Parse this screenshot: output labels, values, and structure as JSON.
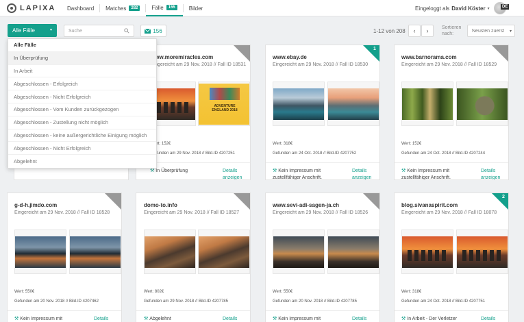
{
  "app": {
    "logo_text": "LAPIXA"
  },
  "nav": {
    "items": [
      {
        "label": "Dashboard"
      },
      {
        "label": "Matches",
        "badge": "282"
      },
      {
        "label": "Fälle",
        "badge": "155"
      },
      {
        "label": "Bilder"
      }
    ],
    "active": "Fälle"
  },
  "user": {
    "prefix": "Eingeloggt als",
    "name": "David Köster",
    "language": "DE"
  },
  "toolbar": {
    "filter_label": "Alle Fälle",
    "search_placeholder": "Suche",
    "mail_count": "156",
    "pager_text": "1-12 von 208",
    "prev_icon": "chevron-left-icon",
    "next_icon": "chevron-right-icon",
    "sort_label_1": "Sortieren",
    "sort_label_2": "nach:",
    "sort_value": "Neusten zuerst"
  },
  "dropdown": {
    "items": [
      "Alle Fälle",
      "In Überprüfung",
      "In Arbeit",
      "Abgeschlossen - Erfolgreich",
      "Abgeschlossen - Nicht Erfolgreich",
      "Abgeschlossen - Vom Kunden zurückgezogen",
      "Abgeschlossen - Zustellung nicht möglich",
      "Abgeschlossen - keine außergerichtliche Einigung möglich",
      "Abgeschlossen - Nicht Erfolgreich",
      "Abgelehnt"
    ],
    "hovered_index": 1
  },
  "cards": [
    {
      "domain": "",
      "meta": "",
      "wert": "",
      "found": "",
      "status": "",
      "details": "",
      "corner": ""
    },
    {
      "domain": "www.moremiracles.com",
      "meta": "Eingereicht am 29 Nov. 2018 // Fall ID 18531",
      "wert": "Wert: 152€",
      "found": "Gefunden am 29 Nov. 2018 // Bild-ID 4207251",
      "status": "In Überprüfung",
      "details": "Details anzeigen",
      "corner": "",
      "book_title": "ADVENTURE ENGLAND 2018"
    },
    {
      "domain": "www.ebay.de",
      "meta": "Eingereicht am 29 Nov. 2018 // Fall ID 18530",
      "wert": "Wert: 318€",
      "found": "Gefunden am 24 Oct. 2018 // Bild-ID 4207752",
      "status": "Kein Impressum mit zustellfähiger Anschrift.",
      "details": "Details anzeigen",
      "corner": "1"
    },
    {
      "domain": "www.barnorama.com",
      "meta": "Eingereicht am 29 Nov. 2018 // Fall ID 18529",
      "wert": "Wert: 152€",
      "found": "Gefunden am 24 Oct. 2018 // Bild-ID 4207244",
      "status": "Kein Impressum mit zustellfähiger Anschrift.",
      "details": "Details anzeigen",
      "corner": ""
    },
    {
      "domain": "g-d-h.jimdo.com",
      "meta": "Eingereicht am 29 Nov. 2018 // Fall ID 18528",
      "wert": "Wert: 550€",
      "found": "Gefunden am 20 Nov. 2018 // Bild-ID 4207462",
      "status": "Kein Impressum mit zustellfähiger Anschrift.",
      "details": "Details anzeigen",
      "corner": ""
    },
    {
      "domain": "domo-to.info",
      "meta": "Eingereicht am 29 Nov. 2018 // Fall ID 18527",
      "wert": "Wert: 802€",
      "found": "Gefunden am 29 Nov. 2018 // Bild-ID 4207785",
      "status": "Abgelehnt",
      "details": "Details anzeigen",
      "corner": ""
    },
    {
      "domain": "www.sevi-adi-sagen-ja.ch",
      "meta": "Eingereicht am 29 Nov. 2018 // Fall ID 18526",
      "wert": "Wert: 550€",
      "found": "Gefunden am 20 Nov. 2018 // Bild-ID 4207785",
      "status": "Kein Impressum mit zustellfähiger Anschrift.",
      "details": "Details anzeigen",
      "corner": ""
    },
    {
      "domain": "blog.sivanaspirit.com",
      "meta": "Eingereicht am 29 Nov. 2018 // Fall ID 18078",
      "wert": "Wert: 318€",
      "found": "Gefunden am 24 Oct. 2018 // Bild-ID 4207751",
      "status": "In Arbeit - Der Verletzer wurde benachrichtigt.",
      "details": "Details anzeigen",
      "corner": "2"
    }
  ],
  "colors": {
    "accent": "#14a08c",
    "corner_grey": "#999999"
  }
}
